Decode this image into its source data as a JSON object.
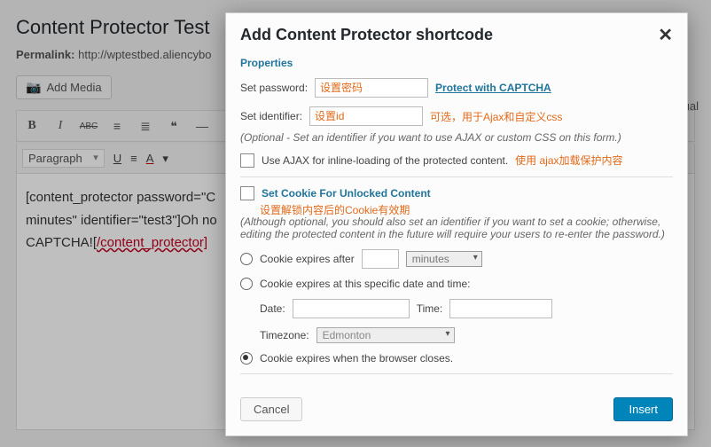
{
  "page": {
    "title": "Content Protector Test",
    "permalink_label": "Permalink:",
    "permalink_url": "http://wptestbed.aliencybo",
    "add_media": "Add Media",
    "visual_tab": "Visual",
    "para_select": "Paragraph",
    "toolbar2": {
      "u": "U",
      "a": "A"
    }
  },
  "editor": {
    "line1_a": "[content_protector password=\"C",
    "line2_a": "minutes\" identifier=\"test3\"]Oh no",
    "line3_a": "CAPTCHA![",
    "line3_b": "/content_protector]"
  },
  "dialog": {
    "title": "Add Content Protector shortcode",
    "section_properties": "Properties",
    "set_password_label": "Set password:",
    "set_password_anno": "设置密码",
    "captcha_link": "Protect with CAPTCHA",
    "set_identifier_label": "Set identifier:",
    "set_identifier_anno": "设置id",
    "identifier_side_anno": "可选，用于Ajax和自定义css",
    "identifier_note": "(Optional - Set an identifier if you want to use AJAX or custom CSS on this form.)",
    "ajax_label": "Use AJAX for inline-loading of the protected content.",
    "ajax_anno": "使用 ajax加载保护内容",
    "cookie_header": "Set Cookie For Unlocked Content",
    "cookie_header_anno": "设置解锁内容后的Cookie有效期",
    "cookie_note": "(Although optional, you should also set an identifier if you want to set a cookie; otherwise, editing the protected content in the future will require your users to re-enter the password.)",
    "opt_after_label": "Cookie expires after",
    "opt_after_unit": "minutes",
    "opt_date_label": "Cookie expires at this specific date and time:",
    "date_label": "Date:",
    "time_label": "Time:",
    "timezone_label": "Timezone:",
    "timezone_value": "Edmonton",
    "opt_browser_label": "Cookie expires when the browser closes.",
    "cancel": "Cancel",
    "insert": "Insert"
  }
}
